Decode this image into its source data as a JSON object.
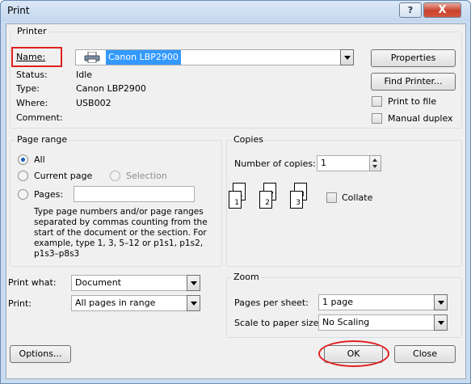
{
  "window": {
    "title": "Print",
    "help_label": "?",
    "close_label": "X"
  },
  "printer": {
    "group_label": "Printer",
    "name_label": "Name:",
    "name_value": "Canon LBP2900",
    "status_label": "Status:",
    "status_value": "Idle",
    "type_label": "Type:",
    "type_value": "Canon LBP2900",
    "where_label": "Where:",
    "where_value": "USB002",
    "comment_label": "Comment:",
    "comment_value": "",
    "properties_label": "Properties",
    "find_printer_label": "Find Printer...",
    "print_to_file_label": "Print to file",
    "manual_duplex_label": "Manual duplex"
  },
  "page_range": {
    "group_label": "Page range",
    "all_label": "All",
    "current_page_label": "Current page",
    "selection_label": "Selection",
    "pages_label": "Pages:",
    "pages_value": "",
    "help_text": "Type page numbers and/or page ranges separated by commas counting from the start of the document or the section. For example, type 1, 3, 5–12 or p1s1, p1s2, p1s3–p8s3"
  },
  "copies": {
    "group_label": "Copies",
    "number_label": "Number of copies:",
    "number_value": "1",
    "collate_label": "Collate",
    "pages": [
      [
        "1",
        "1"
      ],
      [
        "2",
        "2"
      ],
      [
        "3",
        "3"
      ]
    ]
  },
  "print_what": {
    "label": "Print what:",
    "value": "Document"
  },
  "print": {
    "label": "Print:",
    "value": "All pages in range"
  },
  "zoom": {
    "group_label": "Zoom",
    "pages_per_sheet_label": "Pages per sheet:",
    "pages_per_sheet_value": "1 page",
    "scale_label": "Scale to paper size:",
    "scale_value": "No Scaling"
  },
  "buttons": {
    "options_label": "Options...",
    "ok_label": "OK",
    "close_label": "Close"
  },
  "colors": {
    "selection_highlight": "#3399ff",
    "annotation_red": "#e02020"
  }
}
